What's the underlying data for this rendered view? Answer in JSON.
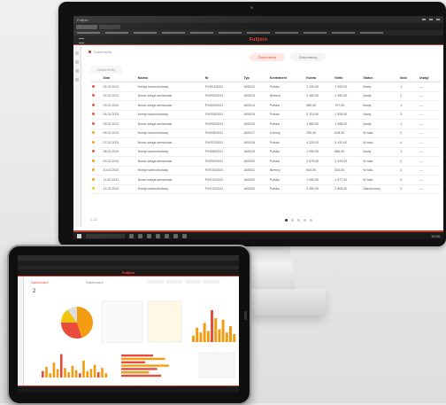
{
  "monitor": {
    "window_title": "Fulljoin",
    "app_name": "Fulljoin",
    "breadcrumb": "Dokumenty",
    "segments": [
      "Dokumenty",
      "Dokumenty"
    ],
    "filter_label": "Dokumenty",
    "columns": [
      "",
      "Data",
      "Nazwa",
      "Nr",
      "Typ",
      "Kontrahent",
      "Kwota",
      "Netto",
      "Status",
      "Ilość",
      "Uwagi"
    ],
    "rows": [
      {
        "status_color": "#e74c3c",
        "cells": [
          "01.02.2021",
          "Kredyt samochodowy",
          "FV/001/2021",
          "A00012",
          "Polska",
          "1 230,00",
          "1 000,00",
          "Nowy",
          "1",
          "—"
        ]
      },
      {
        "status_color": "#e74c3c",
        "cells": [
          "02.02.2021",
          "Nowa usługa serwisowa",
          "FV/002/2021",
          "A00013",
          "Niemcy",
          "2 450,00",
          "1 990,00",
          "Nowy",
          "2",
          "—"
        ]
      },
      {
        "status_color": "#e74c3c",
        "cells": [
          "03.02.2021",
          "Nowa usługa serwisowa",
          "FV/003/2021",
          "A00014",
          "Polska",
          "980,00",
          "797,00",
          "Nowy",
          "1",
          "—"
        ]
      },
      {
        "status_color": "#e74c3c",
        "cells": [
          "04.02.2021",
          "Kredyt samochodowy",
          "FV/004/2021",
          "A00015",
          "Polska",
          "3 110,00",
          "2 528,00",
          "Nowy",
          "3",
          "—"
        ]
      },
      {
        "status_color": "#e74c3c",
        "cells": [
          "05.02.2021",
          "Nowa usługa serwisowa",
          "FV/005/2021",
          "A00016",
          "Polska",
          "1 560,00",
          "1 268,00",
          "Nowy",
          "1",
          "—"
        ]
      },
      {
        "status_color": "#f39c12",
        "cells": [
          "06.02.2021",
          "Kredyt samochodowy",
          "FV/006/2021",
          "A00017",
          "Czechy",
          "760,00",
          "618,00",
          "W toku",
          "2",
          "—"
        ]
      },
      {
        "status_color": "#f39c12",
        "cells": [
          "07.02.2021",
          "Nowa usługa serwisowa",
          "FV/007/2021",
          "A00018",
          "Polska",
          "4 220,00",
          "3 431,00",
          "W toku",
          "4",
          "—"
        ]
      },
      {
        "status_color": "#e74c3c",
        "cells": [
          "08.02.2021",
          "Kredyt samochodowy",
          "FV/008/2021",
          "A00019",
          "Polska",
          "1 090,00",
          "886,00",
          "Nowy",
          "1",
          "—"
        ]
      },
      {
        "status_color": "#f39c12",
        "cells": [
          "09.02.2021",
          "Nowa usługa serwisowa",
          "FV/009/2021",
          "A00020",
          "Polska",
          "2 870,00",
          "2 333,00",
          "W toku",
          "2",
          "—"
        ]
      },
      {
        "status_color": "#f39c12",
        "cells": [
          "10.02.2021",
          "Kredyt samochodowy",
          "FV/010/2021",
          "A00021",
          "Niemcy",
          "640,00",
          "520,00",
          "W toku",
          "1",
          "—"
        ]
      },
      {
        "status_color": "#f39c12",
        "cells": [
          "11.02.2021",
          "Nowa usługa serwisowa",
          "FV/011/2021",
          "A00022",
          "Polska",
          "1 940,00",
          "1 577,00",
          "W toku",
          "3",
          "—"
        ]
      },
      {
        "status_color": "#f1c40f",
        "cells": [
          "12.02.2021",
          "Kredyt samochodowy",
          "FV/012/2021",
          "A00023",
          "Polska",
          "3 450,00",
          "2 805,00",
          "Zakończony",
          "2",
          "—"
        ]
      }
    ],
    "totals": "1–12",
    "clock": "12:00"
  },
  "tablet": {
    "app_name": "Fulljoin",
    "crumb": "Dashboard",
    "segment": "Dashboard",
    "big_label": "2",
    "pie": [
      {
        "color": "#f39c12",
        "value": 45
      },
      {
        "color": "#e74c3c",
        "value": 30
      },
      {
        "color": "#f1c40f",
        "value": 15
      },
      {
        "color": "#ddd",
        "value": 10
      }
    ],
    "bars_a": [
      6,
      10,
      4,
      14,
      8,
      22,
      9,
      5,
      11,
      7,
      4,
      16,
      6,
      8,
      12,
      5,
      9,
      4
    ],
    "bars_b": [
      4,
      9,
      6,
      12,
      7,
      20,
      15,
      8,
      14,
      6,
      10,
      5
    ],
    "hbars": [
      40,
      55,
      30,
      60,
      45,
      35,
      50
    ]
  }
}
